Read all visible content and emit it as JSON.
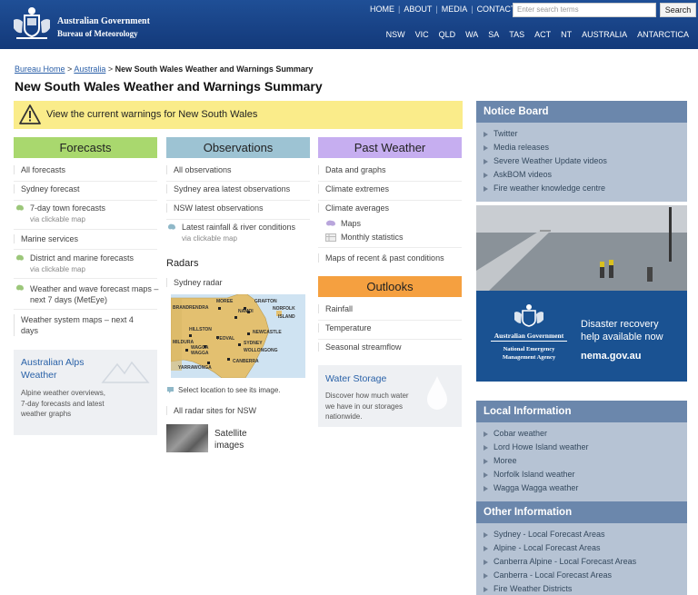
{
  "header": {
    "govt": "Australian Government",
    "bom": "Bureau of Meteorology",
    "topnav": [
      "HOME",
      "ABOUT",
      "MEDIA",
      "CONTACTS"
    ],
    "search_placeholder": "Enter search terms",
    "search_label": "Search",
    "statenav": [
      "NSW",
      "VIC",
      "QLD",
      "WA",
      "SA",
      "TAS",
      "ACT",
      "NT",
      "AUSTRALIA",
      "ANTARCTICA"
    ]
  },
  "breadcrumb": {
    "home": "Bureau Home",
    "australia": "Australia",
    "sep": ">",
    "current": "New South Wales Weather and Warnings Summary"
  },
  "page_title": "New South Wales Weather and Warnings Summary",
  "warning_text": "View the current warnings for New South Wales",
  "forecasts": {
    "heading": "Forecasts",
    "items": [
      "All forecasts",
      "Sydney forecast",
      "7-day town forecasts",
      "Marine services",
      "District and marine forecasts",
      "Weather and wave forecast maps – next 7 days (MetEye)",
      "Weather system maps – next 4 days"
    ],
    "via_map": "via clickable map",
    "alps_title": "Australian Alps Weather",
    "alps_text": "Alpine weather overviews, 7-day forecasts and latest weather graphs"
  },
  "observations": {
    "heading": "Observations",
    "items": [
      "All observations",
      "Sydney area latest observations",
      "NSW latest observations",
      "Latest rainfall & river conditions"
    ],
    "via_map": "via clickable map",
    "radars_heading": "Radars",
    "sydney_radar": "Sydney radar",
    "map_places": [
      "MOREE",
      "GRAFTON",
      "BRANDRENDRA",
      "NAMOI",
      "NORFOLK",
      "ISLAND",
      "HILLSTON",
      "NEWCASTLE",
      "YEOVAL",
      "MILDURA",
      "WAGGA",
      "WAGGA",
      "SYDNEY",
      "WOLLONGONG",
      "CANBERRA",
      "YARRAWONGA"
    ],
    "select_location": "Select location to see its image.",
    "all_radar": "All radar sites for NSW",
    "satellite": "Satellite images"
  },
  "past_weather": {
    "heading": "Past Weather",
    "items": [
      "Data and graphs",
      "Climate extremes",
      "Climate averages"
    ],
    "maps": "Maps",
    "monthly": "Monthly statistics",
    "maps_recent": "Maps of recent & past conditions"
  },
  "outlooks": {
    "heading": "Outlooks",
    "items": [
      "Rainfall",
      "Temperature",
      "Seasonal streamflow"
    ],
    "storage_title": "Water Storage",
    "storage_text": "Discover how much water we have in our storages nationwide."
  },
  "notice_board": {
    "heading": "Notice Board",
    "items": [
      "Twitter",
      "Media releases",
      "Severe Weather Update videos",
      "AskBOM videos",
      "Fire weather knowledge centre"
    ]
  },
  "nema_ad": {
    "govt": "Australian Government",
    "agency": "National Emergency Management Agency",
    "line1": "Disaster recovery",
    "line2": "help available now",
    "url": "nema.gov.au"
  },
  "local_info": {
    "heading": "Local Information",
    "items": [
      "Cobar weather",
      "Lord Howe Island weather",
      "Moree",
      "Norfolk Island weather",
      "Wagga Wagga weather"
    ]
  },
  "other_info": {
    "heading": "Other Information",
    "items": [
      "Sydney - Local Forecast Areas",
      "Alpine - Local Forecast Areas",
      "Canberra Alpine - Local Forecast Areas",
      "Canberra - Local Forecast Areas",
      "Fire Weather Districts"
    ]
  },
  "colors": {
    "header": "#1a4688",
    "forecasts": "#a9d86e",
    "observations": "#9dc3d3",
    "past_weather": "#c6aef0",
    "outlooks": "#f5a040",
    "warning_bg": "#faec8a",
    "right_panel": "#b6c3d4",
    "right_head": "#6b87ac",
    "nema_bg": "#1a5292"
  }
}
